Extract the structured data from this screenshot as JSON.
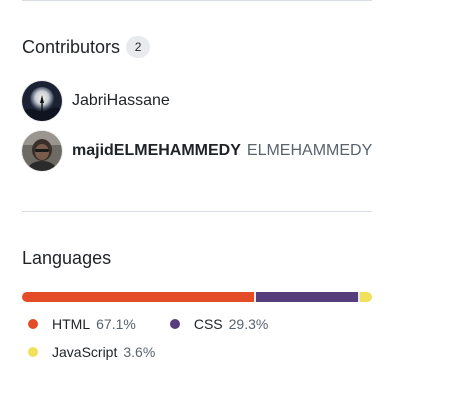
{
  "contributors": {
    "title": "Contributors",
    "count": "2",
    "items": [
      {
        "login": "JabriHassane",
        "name": ""
      },
      {
        "login": "majidELMEHAMMEDY",
        "name": "ELMEHAMMEDY"
      }
    ]
  },
  "languages": {
    "title": "Languages",
    "items": [
      {
        "name": "HTML",
        "percent": "67.1%",
        "value": 67.1,
        "color": "#e34c26"
      },
      {
        "name": "CSS",
        "percent": "29.3%",
        "value": 29.3,
        "color": "#563d7c"
      },
      {
        "name": "JavaScript",
        "percent": "3.6%",
        "value": 3.6,
        "color": "#f1e05a"
      }
    ]
  }
}
